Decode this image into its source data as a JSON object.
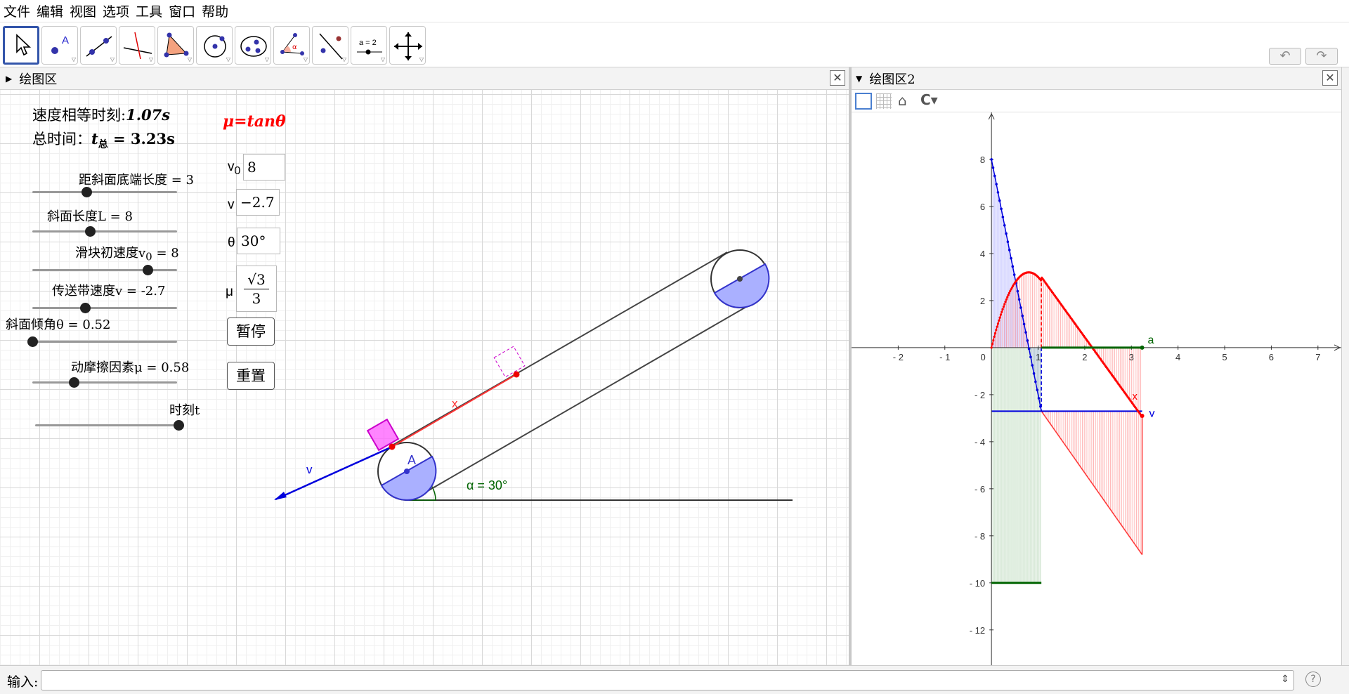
{
  "menu": [
    "文件",
    "编辑",
    "视图",
    "选项",
    "工具",
    "窗口",
    "帮助"
  ],
  "toolbar": {
    "undo": "↶",
    "redo": "↷",
    "help": "?",
    "settings": "⚙",
    "tool_a_label": "A",
    "tool_alpha_label": "α",
    "tool_slider_label": "a = 2"
  },
  "panel1": {
    "title": "绘图区",
    "close": "✕"
  },
  "panel2": {
    "title": "绘图区2",
    "close": "✕"
  },
  "info": {
    "equal_time_label": "速度相等时刻:",
    "equal_time_value": "1.07s",
    "total_label": "总时间：",
    "t_symbol": "t",
    "t_sub": "总",
    "total_value": " = 3.23s",
    "mu_formula": "μ=tanθ"
  },
  "sliders": [
    {
      "label": "距斜面底端长度 = 3",
      "value": 3,
      "min": 0,
      "max": 8
    },
    {
      "label": "斜面长度L = 8",
      "value": 8,
      "min": 0,
      "max": 20
    },
    {
      "label": "滑块初速度v",
      "sub": "0",
      "suffix": " = 8",
      "value": 8,
      "min": 0,
      "max": 10
    },
    {
      "label": "传送带速度v = -2.7",
      "value": -2.7,
      "min": -10,
      "max": 10
    },
    {
      "label": "斜面倾角θ = 0.52",
      "value": 0.52,
      "min": 0.52,
      "max": 1.57
    },
    {
      "label": "动摩擦因素μ = 0.58",
      "value": 0.58,
      "min": 0,
      "max": 2
    },
    {
      "label": "时刻t",
      "value": 1,
      "min": 0,
      "max": 1
    }
  ],
  "fields": {
    "v0_label": "v",
    "v0_sub": "0",
    "v0_value": "8",
    "v_label": "v",
    "v_value": "−2.7",
    "theta_label": "θ",
    "theta_value": "30°",
    "mu_label": "μ",
    "mu_num": "√3",
    "mu_den": "3"
  },
  "buttons": {
    "pause": "暂停",
    "reset": "重置"
  },
  "scene": {
    "label_v": "v",
    "label_x": "x",
    "label_A": "A",
    "angle_label": "α = 30°"
  },
  "graph2": {
    "x_ticks": [
      "- 2",
      "- 1",
      "0",
      "1",
      "2",
      "3",
      "4",
      "5",
      "6",
      "7"
    ],
    "y_ticks": [
      "8",
      "6",
      "4",
      "2",
      "- 2",
      "- 4",
      "- 6",
      "- 8",
      "- 10",
      "- 12"
    ],
    "label_a": "a",
    "label_x": "x",
    "label_v": "v"
  },
  "chart_data": {
    "type": "line",
    "series": [
      {
        "name": "v",
        "points": [
          [
            0,
            8
          ],
          [
            1.07,
            -2.7
          ],
          [
            3.23,
            -2.7
          ]
        ]
      },
      {
        "name": "x",
        "points": [
          [
            0,
            0
          ],
          [
            0.4,
            2.2
          ],
          [
            0.8,
            3.2
          ],
          [
            1.07,
            2.9
          ],
          [
            2.0,
            0.5
          ],
          [
            3.23,
            -2.9
          ]
        ]
      },
      {
        "name": "a",
        "points": [
          [
            0,
            -10
          ],
          [
            1.07,
            -10
          ],
          [
            1.07,
            0
          ],
          [
            3.23,
            0
          ]
        ]
      }
    ],
    "xlim": [
      -3,
      7.5
    ],
    "ylim": [
      -13.5,
      10
    ],
    "grid": false
  },
  "input": {
    "label": "输入:",
    "help": "?",
    "dropdown": "⇕"
  },
  "colors": {
    "accent": "#3355aa",
    "red": "#ff0000",
    "blue": "#0000dd",
    "green": "#006400",
    "magenta": "#ff33ff"
  }
}
